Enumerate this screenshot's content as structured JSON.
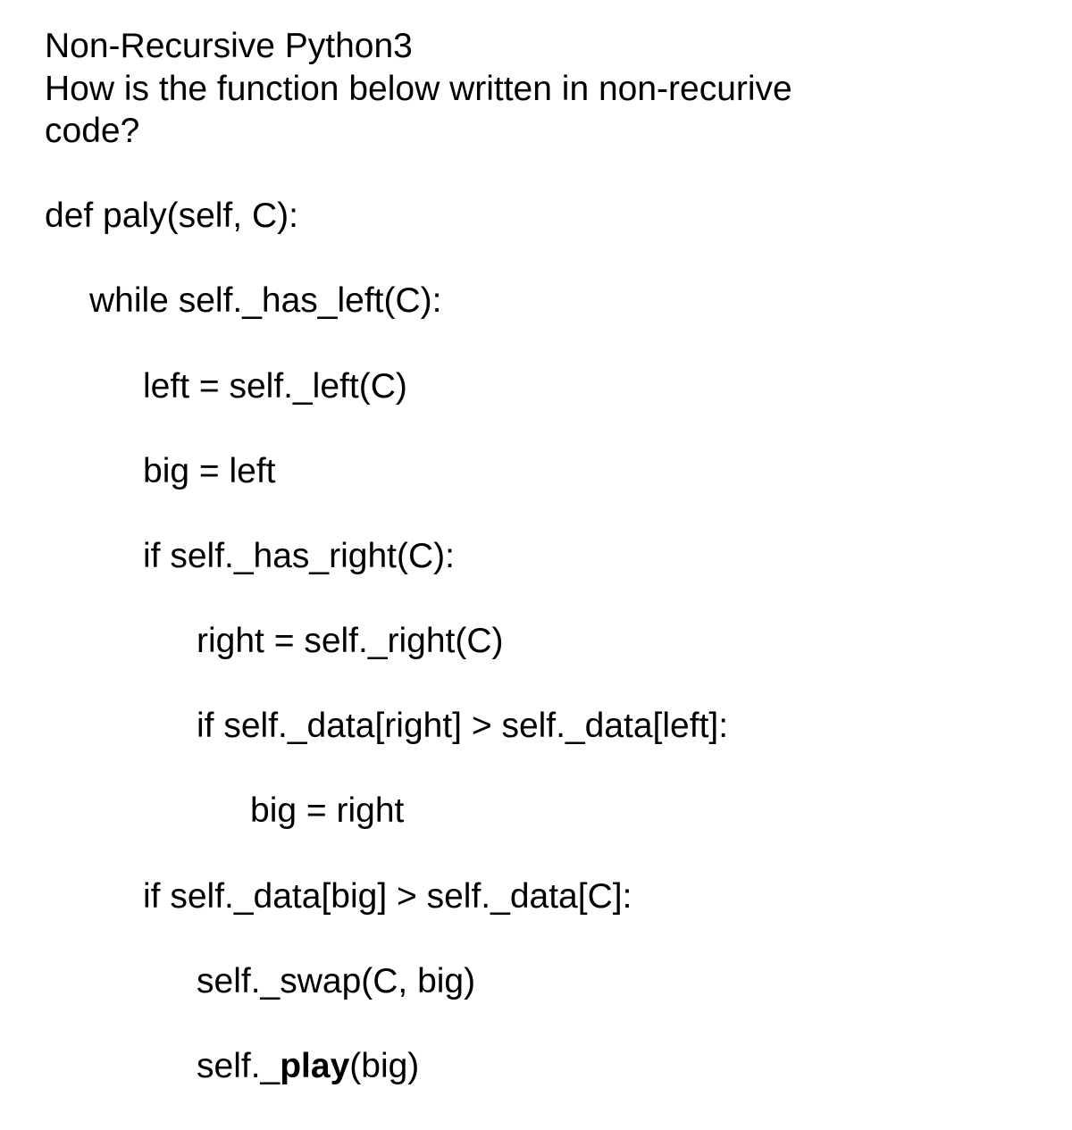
{
  "title": "Non-Recursive Python3",
  "question_line1": "How is the function below written in non-recurive",
  "question_line2": "code?",
  "code": {
    "l0": "def paly(self, C):",
    "l1": "while self._has_left(C):",
    "l2": "left = self._left(C)",
    "l3": "big = left",
    "l4": "if self._has_right(C):",
    "l5": "right = self._right(C)",
    "l6": "if self._data[right] > self._data[left]:",
    "l7": "big = right",
    "l8": "if self._data[big] > self._data[C]:",
    "l9": "self._swap(C, big)",
    "l10a": "self._",
    "l10b": "play",
    "l10c": "(big)"
  }
}
